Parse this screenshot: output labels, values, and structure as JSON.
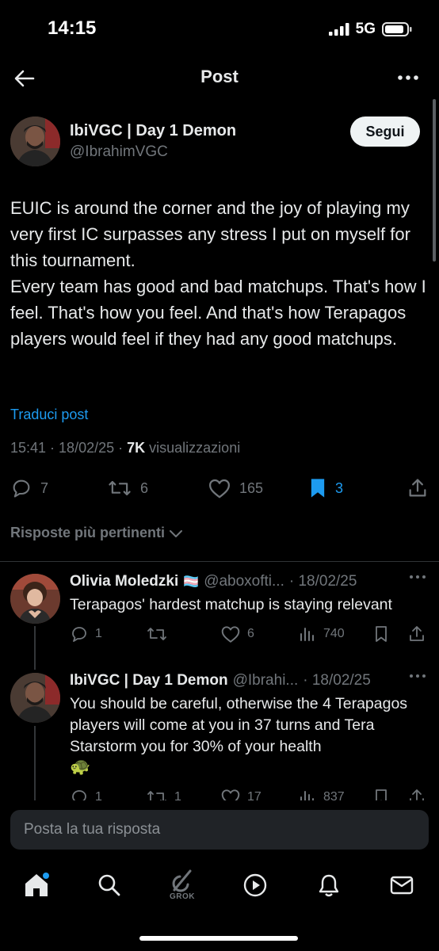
{
  "status_bar": {
    "time": "14:15",
    "network": "5G"
  },
  "header": {
    "title": "Post"
  },
  "post": {
    "author_name": "IbiVGC | Day 1 Demon",
    "author_handle": "@IbrahimVGC",
    "follow_label": "Segui",
    "text": "EUIC is around the corner and the joy of playing my very first IC surpasses any stress I put on myself for this tournament.\nEvery team has good and bad matchups. That's how I feel. That's how you feel. And that's how Terapagos players would feel if they had any good matchups.",
    "translate_label": "Traduci post",
    "time": "15:41",
    "date": "18/02/25",
    "views_count": "7K",
    "views_label": "visualizzazioni",
    "replies": "7",
    "reposts": "6",
    "likes": "165",
    "bookmarks": "3"
  },
  "sort": {
    "label": "Risposte più pertinenti"
  },
  "replies": [
    {
      "name": "Olivia Moledzki",
      "flag": "🏳️‍⚧️",
      "handle": "@aboxofti...",
      "date": "· 18/02/25",
      "text": "Terapagos' hardest matchup is staying relevant",
      "replies": "1",
      "reposts": "",
      "likes": "6",
      "views": "740"
    },
    {
      "name": "IbiVGC | Day 1 Demon",
      "handle": "@Ibrahi...",
      "date": "· 18/02/25",
      "text": "You should be careful, otherwise the 4 Terapagos players will come at you in 37 turns and Tera Starstorm you for 30% of your health",
      "emoji": "🐢",
      "replies": "1",
      "reposts": "1",
      "likes": "17",
      "views": "837"
    }
  ],
  "composer": {
    "placeholder": "Posta la tua risposta"
  },
  "nav": {
    "grok_label": "GROK"
  },
  "colors": {
    "accent": "#1d9bf0",
    "muted": "#71767b",
    "text": "#e7e9ea",
    "background": "#000000"
  },
  "icons": [
    "back-arrow-icon",
    "more-icon",
    "reply-icon",
    "repost-icon",
    "like-icon",
    "bookmark-icon",
    "share-icon",
    "views-icon",
    "home-icon",
    "search-icon",
    "grok-icon",
    "video-icon",
    "notifications-icon",
    "messages-icon"
  ]
}
